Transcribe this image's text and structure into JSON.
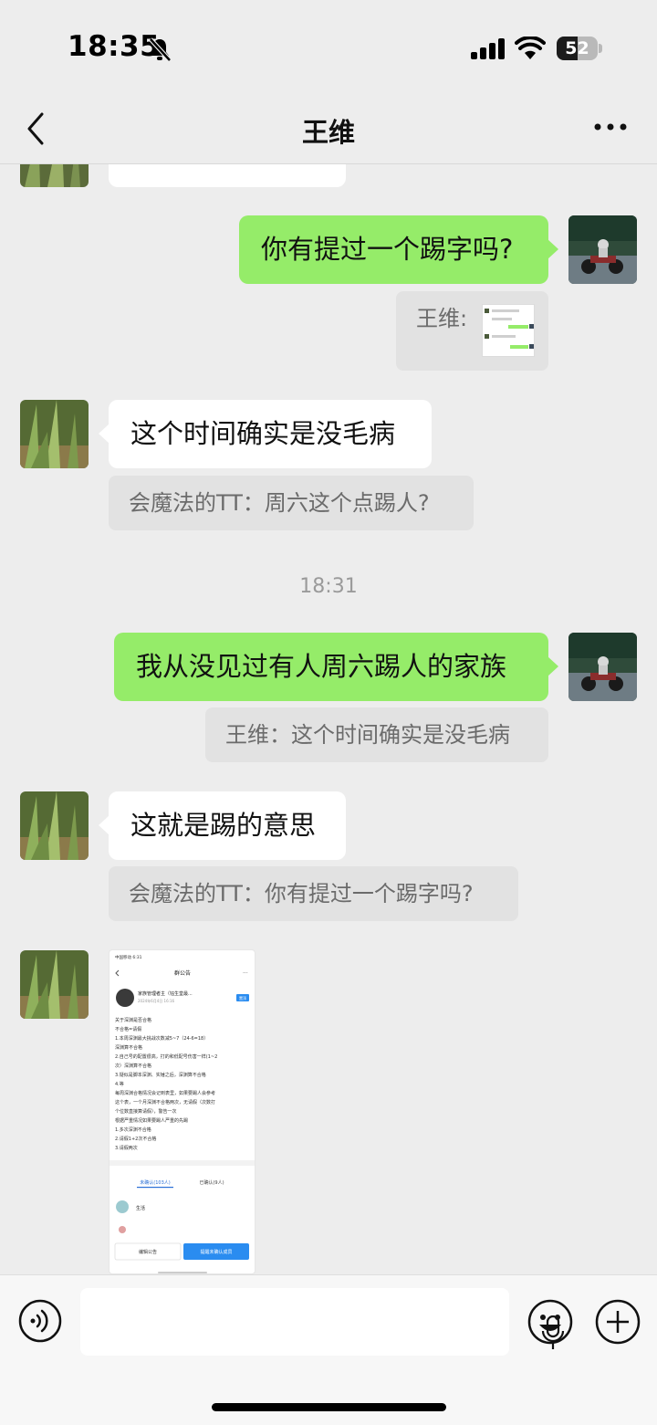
{
  "status": {
    "time": "18:35",
    "battery": "52",
    "battery_level": 0.52
  },
  "nav": {
    "title": "王维"
  },
  "messages": {
    "m1": {
      "text": "你有提过一个踢字吗?"
    },
    "m1_quote": {
      "sender": "王维:"
    },
    "m2": {
      "text": "这个时间确实是没毛病"
    },
    "m2_quote": {
      "text": "会魔法的TT：周六这个点踢人?"
    },
    "timestamp": "18:31",
    "m3": {
      "text": "我从没见过有人周六踢人的家族"
    },
    "m3_quote": {
      "text": "王维：这个时间确实是没毛病"
    },
    "m4": {
      "text": "这就是踢的意思"
    },
    "m4_quote": {
      "text": "会魔法的TT：你有提过一个踢字吗?"
    }
  },
  "screenshot": {
    "status_time": "中国移动 6:31",
    "header": "群公告",
    "author": "家族管理者主（钰生堂最...",
    "date": "2024年6月4日 16:16",
    "badge": "置顶",
    "lines": [
      "关于深渊是否合格",
      "不合格=请假",
      "1.本周深渊最大挑战次数减5~7（24-6=18）",
      "深渊算不合格",
      "2.自己号的配置很高，打的和低配号伤害一样(1~2",
      "次）深渊算不合格",
      "3.疑似是脚本深渊、实锤之后，深渊算不合格",
      "4.等",
      "每周深渊合格情况会记到表里，如果要踢人会参考",
      "这个表，一个月深渊不合格两次，无请假（次数打",
      "个位数直接算请假），警告一次",
      "根据严重情况如果要踢人严重的先踢",
      "1.多次深渊不合格",
      "2.请假1+2次不合格",
      "3.请假两次"
    ],
    "tab_unconfirmed": "未确认(103人)",
    "tab_confirmed": "已确认(9人)",
    "member": "生活",
    "edit_button": "编辑公告",
    "remind_button": "提醒未确认成员"
  }
}
